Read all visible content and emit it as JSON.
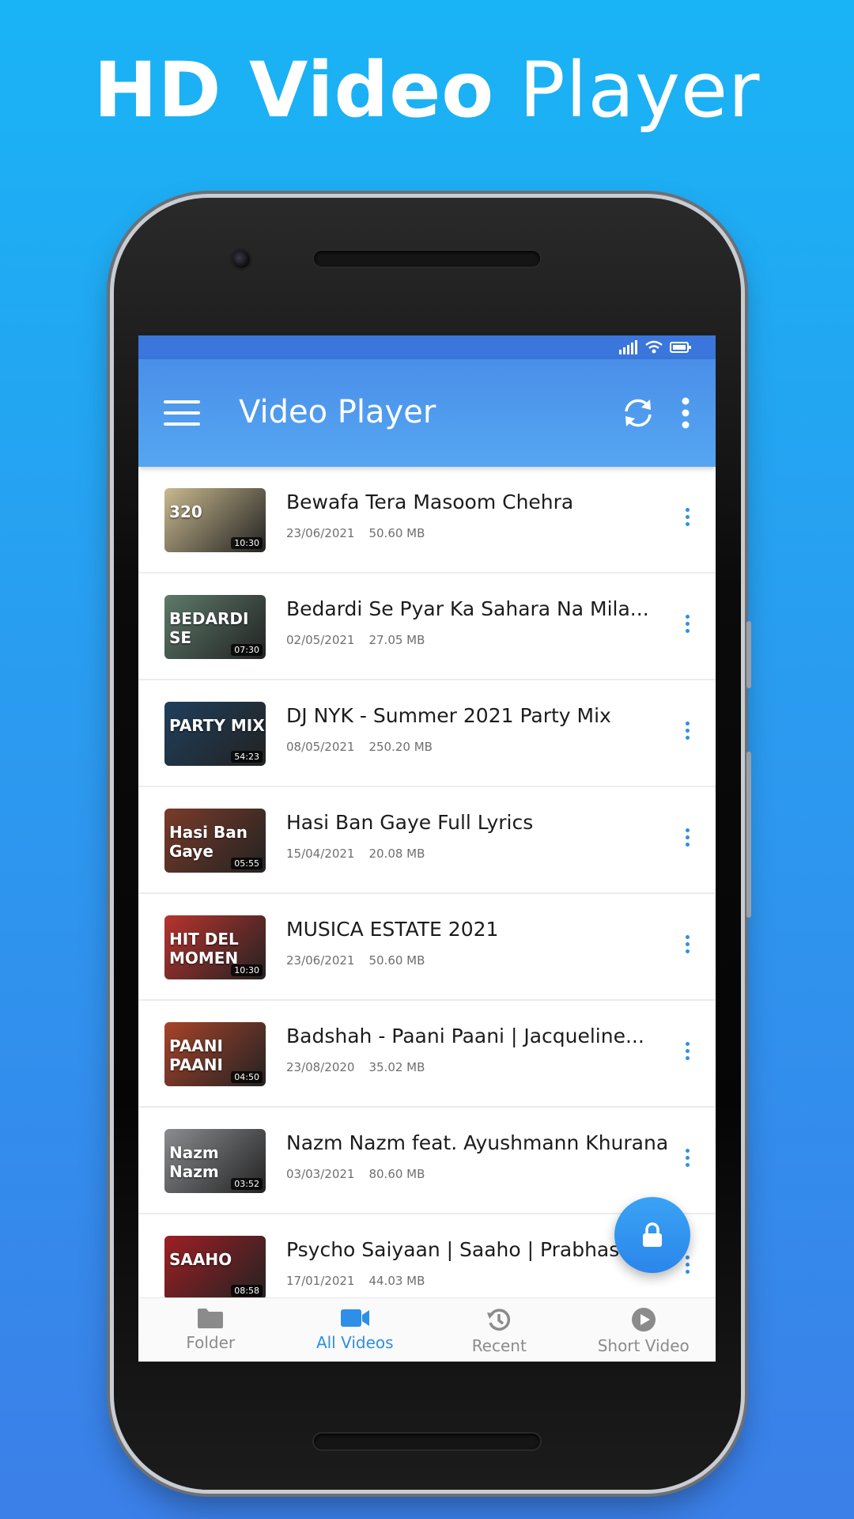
{
  "headline": {
    "bold": "HD Video",
    "light": "Player"
  },
  "app": {
    "title": "Video Player"
  },
  "videos": [
    {
      "title": "Bewafa Tera Masoom Chehra",
      "date": "23/06/2021",
      "size": "50.60 MB",
      "duration": "10:30",
      "thumb_text": "320",
      "thumb_color": "#c9b98f"
    },
    {
      "title": "Bedardi Se Pyar Ka Sahara Na Mila...",
      "date": "02/05/2021",
      "size": "27.05 MB",
      "duration": "07:30",
      "thumb_text": "BEDARDI SE",
      "thumb_color": "#5d7a6a"
    },
    {
      "title": "DJ NYK - Summer 2021 Party Mix",
      "date": "08/05/2021",
      "size": "250.20 MB",
      "duration": "54:23",
      "thumb_text": "PARTY MIX",
      "thumb_color": "#1f3f5c"
    },
    {
      "title": "Hasi Ban Gaye Full Lyrics",
      "date": "15/04/2021",
      "size": "20.08 MB",
      "duration": "05:55",
      "thumb_text": "Hasi Ban Gaye",
      "thumb_color": "#7a3b2a"
    },
    {
      "title": "MUSICA ESTATE 2021",
      "date": "23/06/2021",
      "size": "50.60 MB",
      "duration": "10:30",
      "thumb_text": "HIT DEL MOMEN",
      "thumb_color": "#b8332e"
    },
    {
      "title": "Badshah - Paani Paani | Jacqueline...",
      "date": "23/08/2020",
      "size": "35.02 MB",
      "duration": "04:50",
      "thumb_text": "PAANI PAANI",
      "thumb_color": "#a8432a"
    },
    {
      "title": "Nazm Nazm feat. Ayushmann Khurana",
      "date": "03/03/2021",
      "size": "80.60 MB",
      "duration": "03:52",
      "thumb_text": "Nazm Nazm",
      "thumb_color": "#8a8c8f"
    },
    {
      "title": "Psycho Saiyaan | Saaho | Prabhas...",
      "date": "17/01/2021",
      "size": "44.03 MB",
      "duration": "08:58",
      "thumb_text": "SAAHO",
      "thumb_color": "#9e1f24"
    }
  ],
  "nav": [
    {
      "label": "Folder",
      "icon": "folder-icon"
    },
    {
      "label": "All Videos",
      "icon": "video-camera-icon",
      "active": true
    },
    {
      "label": "Recent",
      "icon": "history-icon"
    },
    {
      "label": "Short Video",
      "icon": "play-circle-icon"
    }
  ],
  "colors": {
    "accent": "#2d8fe8",
    "appbar": "#4a8fe9",
    "background": "#19b4f5"
  }
}
